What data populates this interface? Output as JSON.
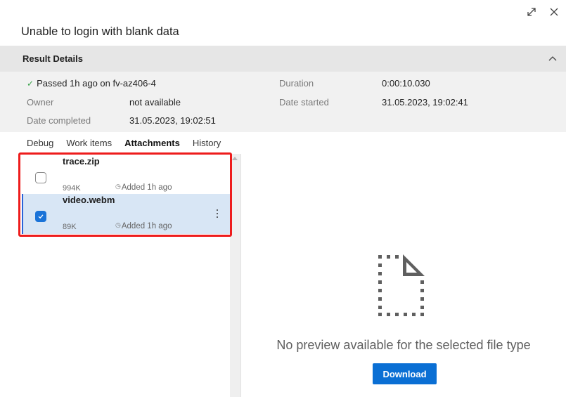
{
  "window": {
    "actions": [
      {
        "name": "expand",
        "icon": "expand-icon"
      },
      {
        "name": "close",
        "icon": "close-icon"
      }
    ]
  },
  "title": "Unable to login with blank data",
  "result_details": {
    "header": "Result Details",
    "collapsed": false,
    "status": "Passed 1h ago on fv-az406-4",
    "status_color": "#3aa34a",
    "fields": {
      "owner_label": "Owner",
      "owner_value": "not available",
      "date_completed_label": "Date completed",
      "date_completed_value": "31.05.2023, 19:02:51",
      "duration_label": "Duration",
      "duration_value": "0:00:10.030",
      "date_started_label": "Date started",
      "date_started_value": "31.05.2023, 19:02:41"
    }
  },
  "tabs": [
    {
      "label": "Debug",
      "active": false
    },
    {
      "label": "Work items",
      "active": false
    },
    {
      "label": "Attachments",
      "active": true
    },
    {
      "label": "History",
      "active": false
    }
  ],
  "attachments": [
    {
      "name": "trace.zip",
      "size": "994K",
      "added": "Added 1h ago",
      "checked": false,
      "selected": false
    },
    {
      "name": "video.webm",
      "size": "89K",
      "added": "Added 1h ago",
      "checked": true,
      "selected": true
    }
  ],
  "preview": {
    "message": "No preview available for the selected file type",
    "download_label": "Download",
    "accent": "#0a6fd4"
  },
  "annotation": {
    "highlight_color": "#ee1c1c"
  }
}
